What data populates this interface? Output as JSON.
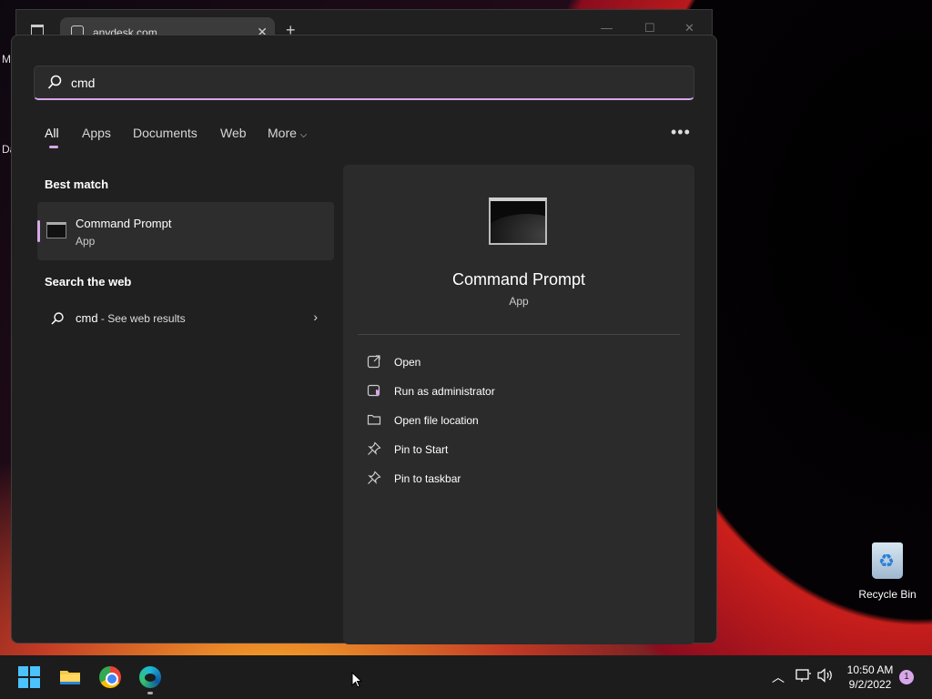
{
  "browser": {
    "tab_title": "anydesk.com",
    "close_tab": "✕",
    "new_tab": "+"
  },
  "desktop_edge": {
    "label1": "M",
    "label2": "Da"
  },
  "search": {
    "value": "cmd"
  },
  "tabs": [
    {
      "label": "All"
    },
    {
      "label": "Apps"
    },
    {
      "label": "Documents"
    },
    {
      "label": "Web"
    },
    {
      "label": "More"
    }
  ],
  "more_options": "•••",
  "best_match": {
    "title": "Best match",
    "name": "Command Prompt",
    "type": "App"
  },
  "web": {
    "title": "Search the web",
    "query": "cmd",
    "suffix": " - See web results"
  },
  "detail": {
    "name": "Command Prompt",
    "type": "App",
    "actions": [
      {
        "label": "Open",
        "icon": "open-icon"
      },
      {
        "label": "Run as administrator",
        "icon": "shield-icon"
      },
      {
        "label": "Open file location",
        "icon": "folder-icon"
      },
      {
        "label": "Pin to Start",
        "icon": "pin-icon"
      },
      {
        "label": "Pin to taskbar",
        "icon": "pin-icon"
      }
    ]
  },
  "desktop": {
    "recycle_bin": "Recycle Bin"
  },
  "taskbar": {
    "time": "10:50 AM",
    "date": "9/2/2022",
    "notifications": "1"
  },
  "colors": {
    "accent": "#d8a7ea",
    "panel": "#202020",
    "detail_bg": "#2b2b2b"
  }
}
